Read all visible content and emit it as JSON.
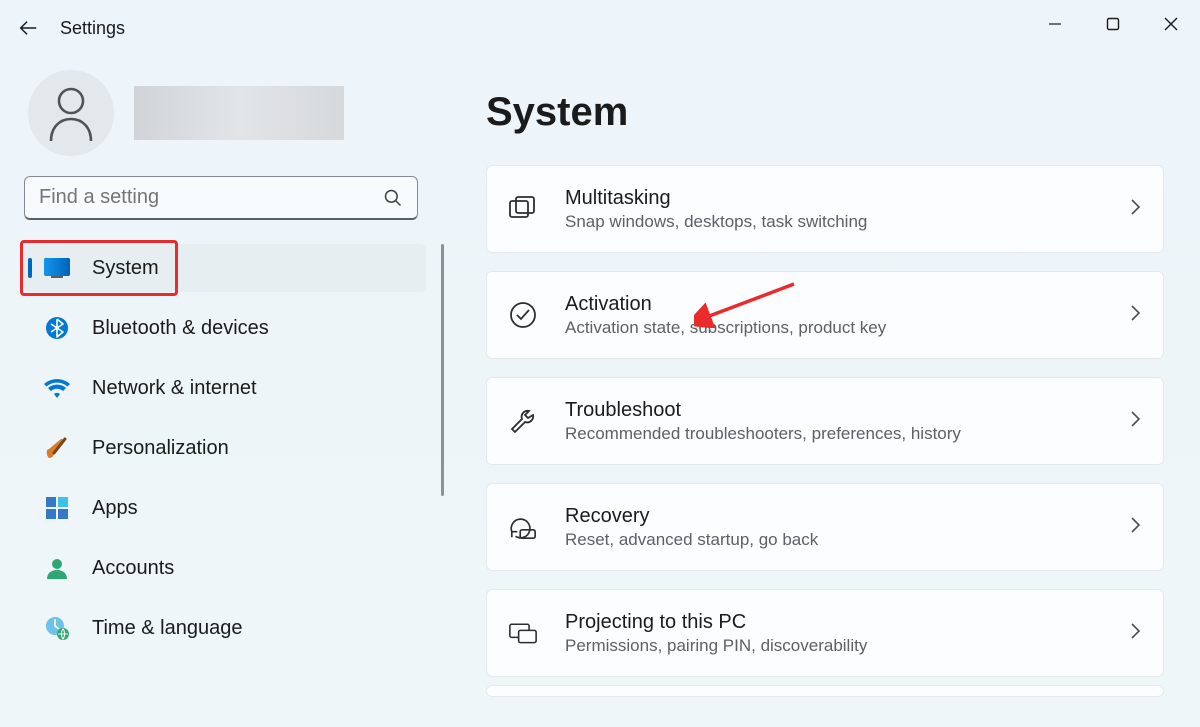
{
  "app": {
    "title": "Settings"
  },
  "search": {
    "placeholder": "Find a setting"
  },
  "sidebar": {
    "items": [
      {
        "label": "System"
      },
      {
        "label": "Bluetooth & devices"
      },
      {
        "label": "Network & internet"
      },
      {
        "label": "Personalization"
      },
      {
        "label": "Apps"
      },
      {
        "label": "Accounts"
      },
      {
        "label": "Time & language"
      }
    ]
  },
  "main": {
    "heading": "System",
    "cards": [
      {
        "title": "Multitasking",
        "sub": "Snap windows, desktops, task switching"
      },
      {
        "title": "Activation",
        "sub": "Activation state, subscriptions, product key"
      },
      {
        "title": "Troubleshoot",
        "sub": "Recommended troubleshooters, preferences, history"
      },
      {
        "title": "Recovery",
        "sub": "Reset, advanced startup, go back"
      },
      {
        "title": "Projecting to this PC",
        "sub": "Permissions, pairing PIN, discoverability"
      }
    ]
  }
}
